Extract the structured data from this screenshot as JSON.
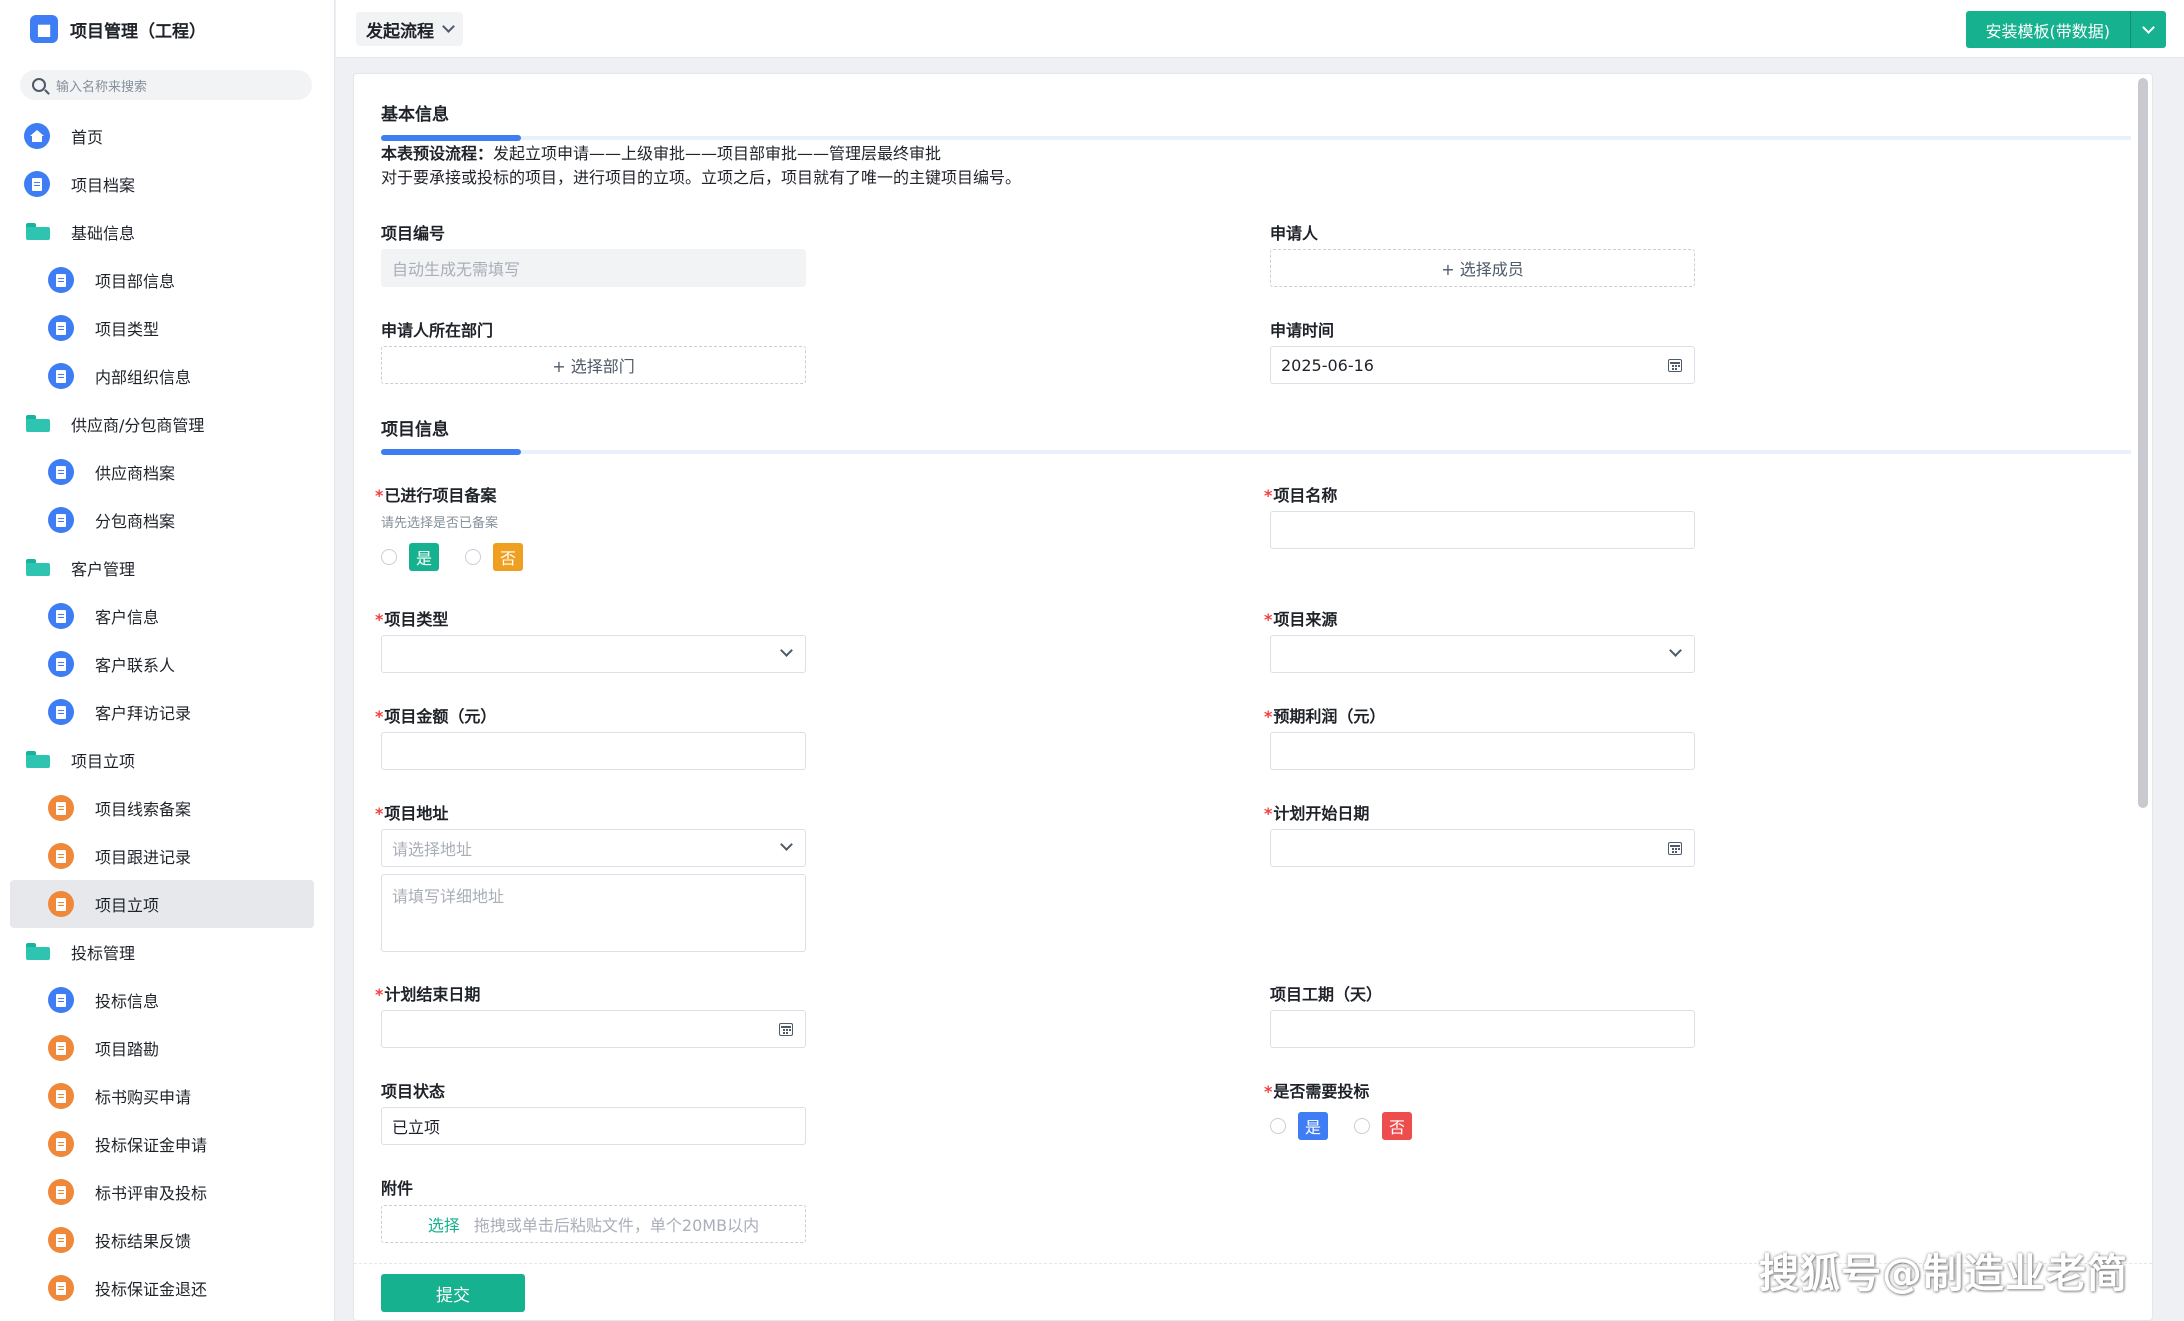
{
  "app": {
    "title": "项目管理（工程）",
    "logo_icon": "puzzle-icon",
    "accent": "#3f7df4",
    "brand_green": "#16b18e"
  },
  "search": {
    "placeholder": "输入名称来搜索"
  },
  "sidebar": {
    "items": [
      {
        "label": "首页",
        "type": "home"
      },
      {
        "label": "项目档案",
        "type": "doc"
      },
      {
        "label": "基础信息",
        "type": "folder"
      },
      {
        "label": "项目部信息",
        "type": "doc"
      },
      {
        "label": "项目类型",
        "type": "doc"
      },
      {
        "label": "内部组织信息",
        "type": "doc"
      },
      {
        "label": "供应商/分包商管理",
        "type": "folder"
      },
      {
        "label": "供应商档案",
        "type": "doc"
      },
      {
        "label": "分包商档案",
        "type": "doc"
      },
      {
        "label": "客户管理",
        "type": "folder"
      },
      {
        "label": "客户信息",
        "type": "doc"
      },
      {
        "label": "客户联系人",
        "type": "doc"
      },
      {
        "label": "客户拜访记录",
        "type": "doc"
      },
      {
        "label": "项目立项",
        "type": "folder"
      },
      {
        "label": "项目线索备案",
        "type": "doc"
      },
      {
        "label": "项目跟进记录",
        "type": "doc"
      },
      {
        "label": "项目立项",
        "type": "doc",
        "active": true
      },
      {
        "label": "投标管理",
        "type": "folder"
      },
      {
        "label": "投标信息",
        "type": "doc"
      },
      {
        "label": "项目踏勘",
        "type": "doc"
      },
      {
        "label": "标书购买申请",
        "type": "doc"
      },
      {
        "label": "投标保证金申请",
        "type": "doc"
      },
      {
        "label": "标书评审及投标",
        "type": "doc"
      },
      {
        "label": "投标结果反馈",
        "type": "doc"
      },
      {
        "label": "投标保证金退还",
        "type": "doc"
      }
    ]
  },
  "topbar": {
    "flow_label": "发起流程",
    "install_label": "安装模板(带数据)"
  },
  "form": {
    "section_basic": "基本信息",
    "desc_prefix": "本表预设流程：",
    "desc_flow": "发起立项申请——上级审批——项目部审批——管理层最终审批",
    "desc_line2": "对于要承接或投标的项目，进行项目的立项。立项之后，项目就有了唯一的主键项目编号。",
    "project_no": {
      "label": "项目编号",
      "placeholder": "自动生成无需填写"
    },
    "applicant": {
      "label": "申请人",
      "button": "+ 选择成员"
    },
    "dept": {
      "label": "申请人所在部门",
      "button": "+ 选择部门"
    },
    "apply_time": {
      "label": "申请时间",
      "value": "2025-06-16"
    },
    "section_project": "项目信息",
    "filed": {
      "label": "已进行项目备案",
      "hint": "请先选择是否已备案",
      "yes": "是",
      "no": "否"
    },
    "project_name": {
      "label": "项目名称"
    },
    "project_type": {
      "label": "项目类型"
    },
    "project_source": {
      "label": "项目来源"
    },
    "amount": {
      "label": "项目金额（元）"
    },
    "profit": {
      "label": "预期利润（元）"
    },
    "address": {
      "label": "项目地址",
      "placeholder": "请选择地址",
      "detail_placeholder": "请填写详细地址"
    },
    "start_date": {
      "label": "计划开始日期"
    },
    "end_date": {
      "label": "计划结束日期"
    },
    "duration": {
      "label": "项目工期（天）"
    },
    "status": {
      "label": "项目状态",
      "value": "已立项"
    },
    "need_bid": {
      "label": "是否需要投标",
      "yes": "是",
      "no": "否"
    },
    "attachment": {
      "label": "附件",
      "pick": "选择",
      "hint": "拖拽或单击后粘贴文件，单个20MB以内"
    },
    "submit": "提交"
  },
  "watermark": "搜狐号@制造业老简"
}
